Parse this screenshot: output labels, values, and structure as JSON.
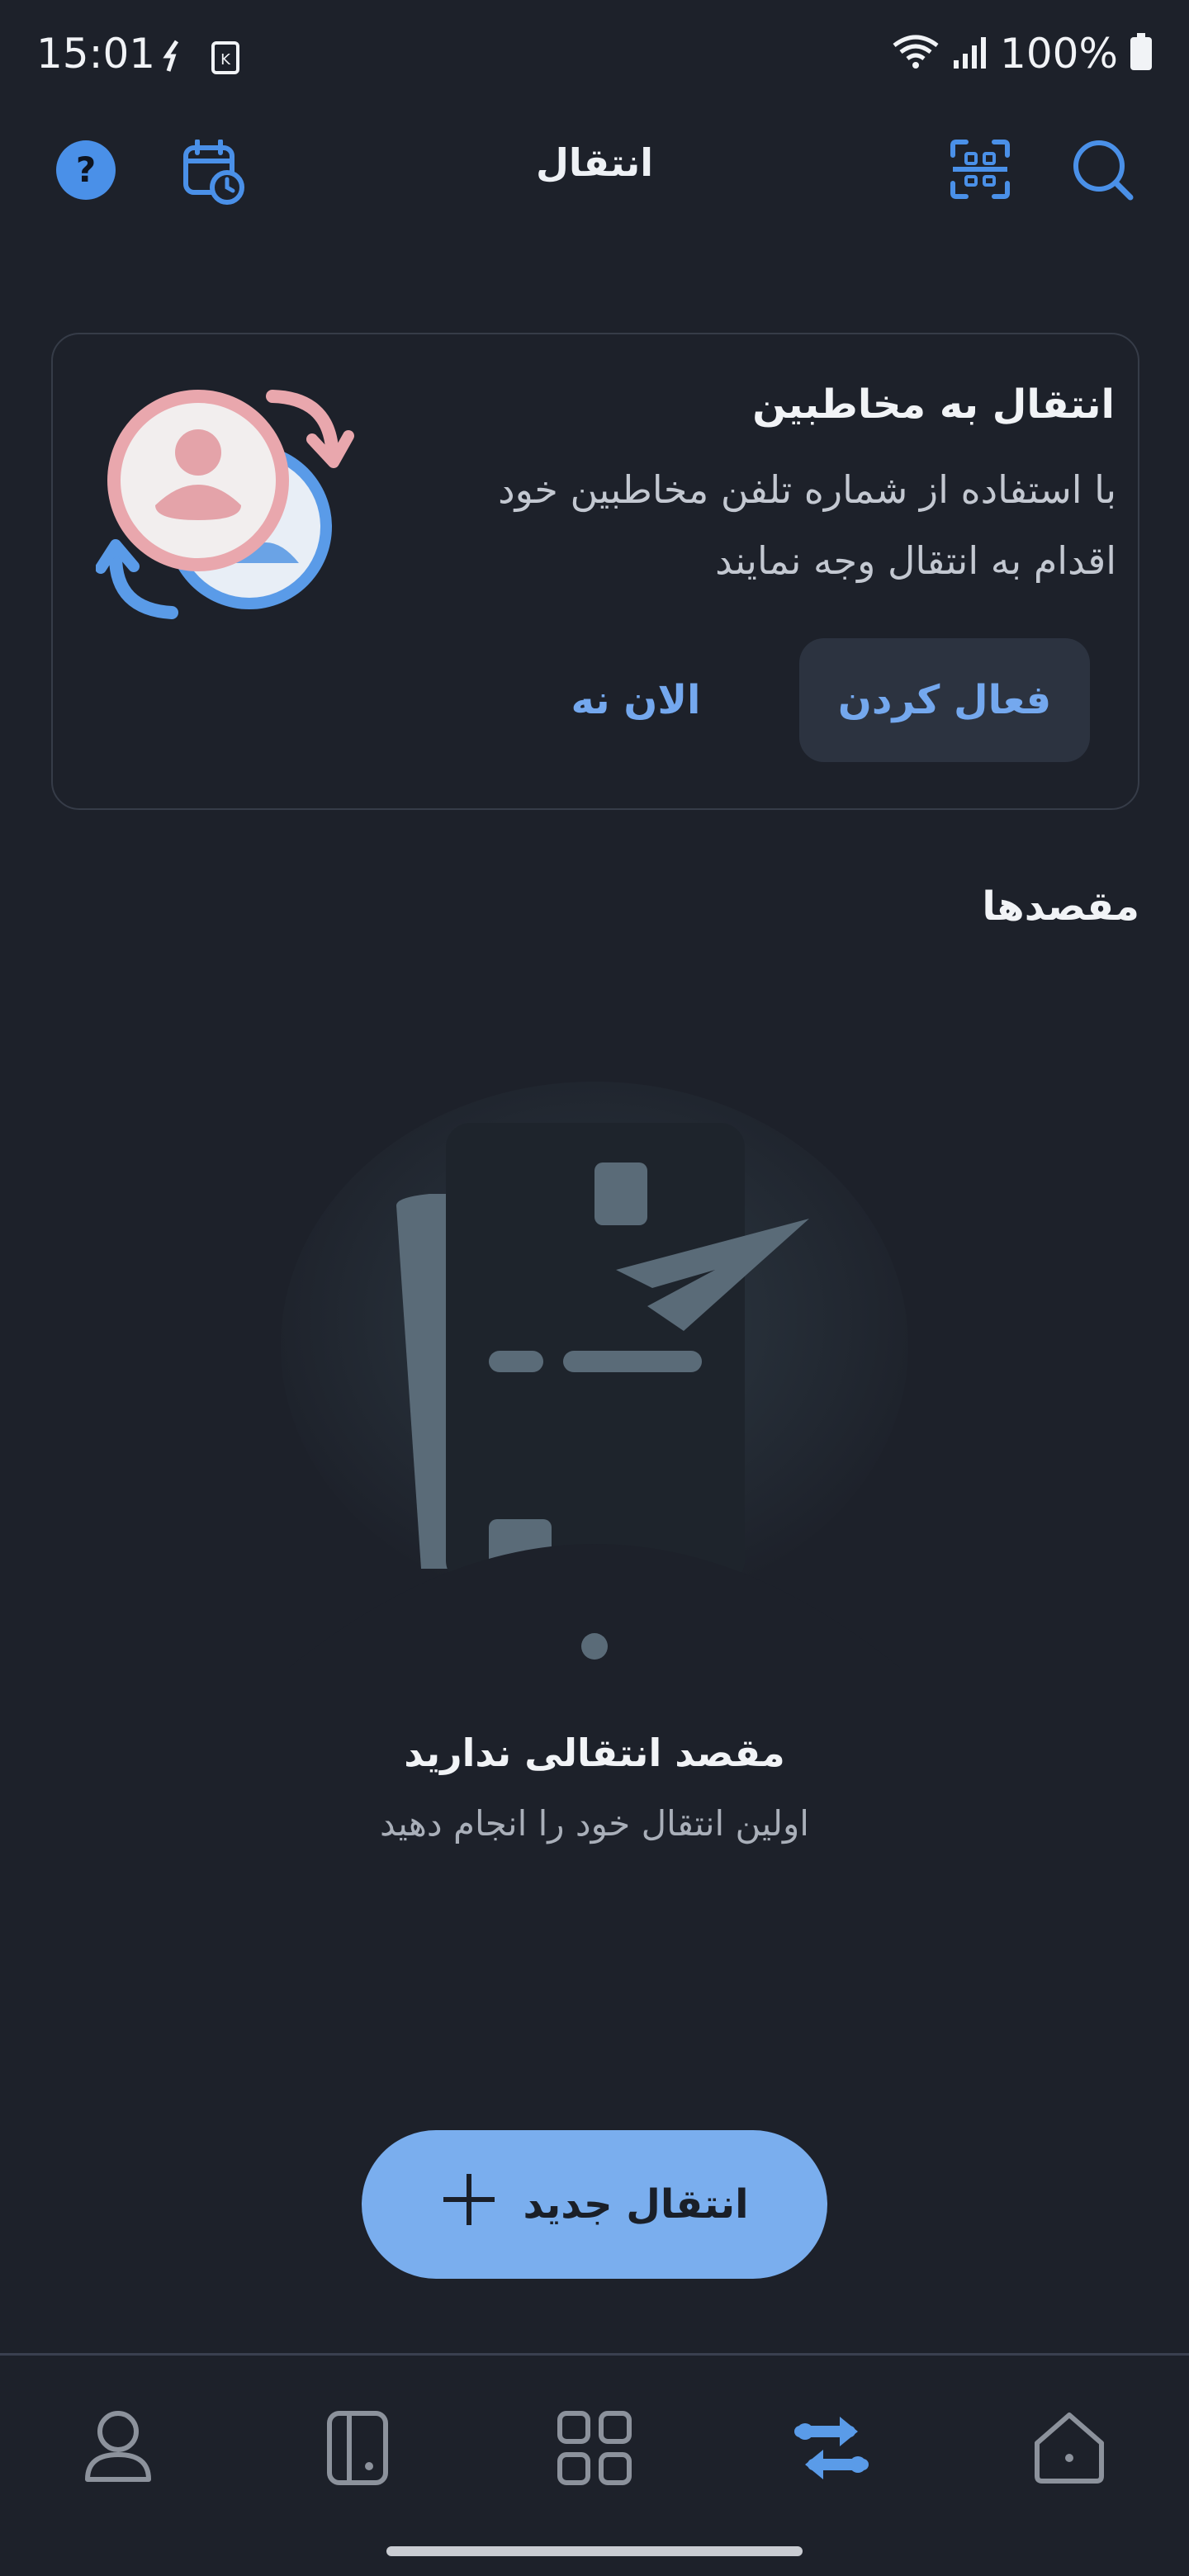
{
  "status_bar": {
    "time": "15:01",
    "battery": "100%"
  },
  "header": {
    "title": "انتقال"
  },
  "promo_card": {
    "title": "انتقال به مخاطبین",
    "description": "با استفاده از شماره تلفن مخاطبین خود اقدام به انتقال وجه نمایند",
    "activate_label": "فعال کردن",
    "later_label": "الان نه"
  },
  "destinations": {
    "title": "مقصدها",
    "empty_title": "مقصد انتقالی ندارید",
    "empty_subtitle": "اولین انتقال خود را انجام دهید"
  },
  "new_transfer": {
    "label": "انتقال جدید"
  },
  "bottom_nav": {
    "items": [
      "profile-icon",
      "card-icon",
      "services-grid-icon",
      "transfer-icon",
      "home-icon"
    ],
    "active": "transfer-icon"
  },
  "colors": {
    "background": "#1d212a",
    "accent": "#74a8ee",
    "button_fill": "#7aaeee"
  }
}
